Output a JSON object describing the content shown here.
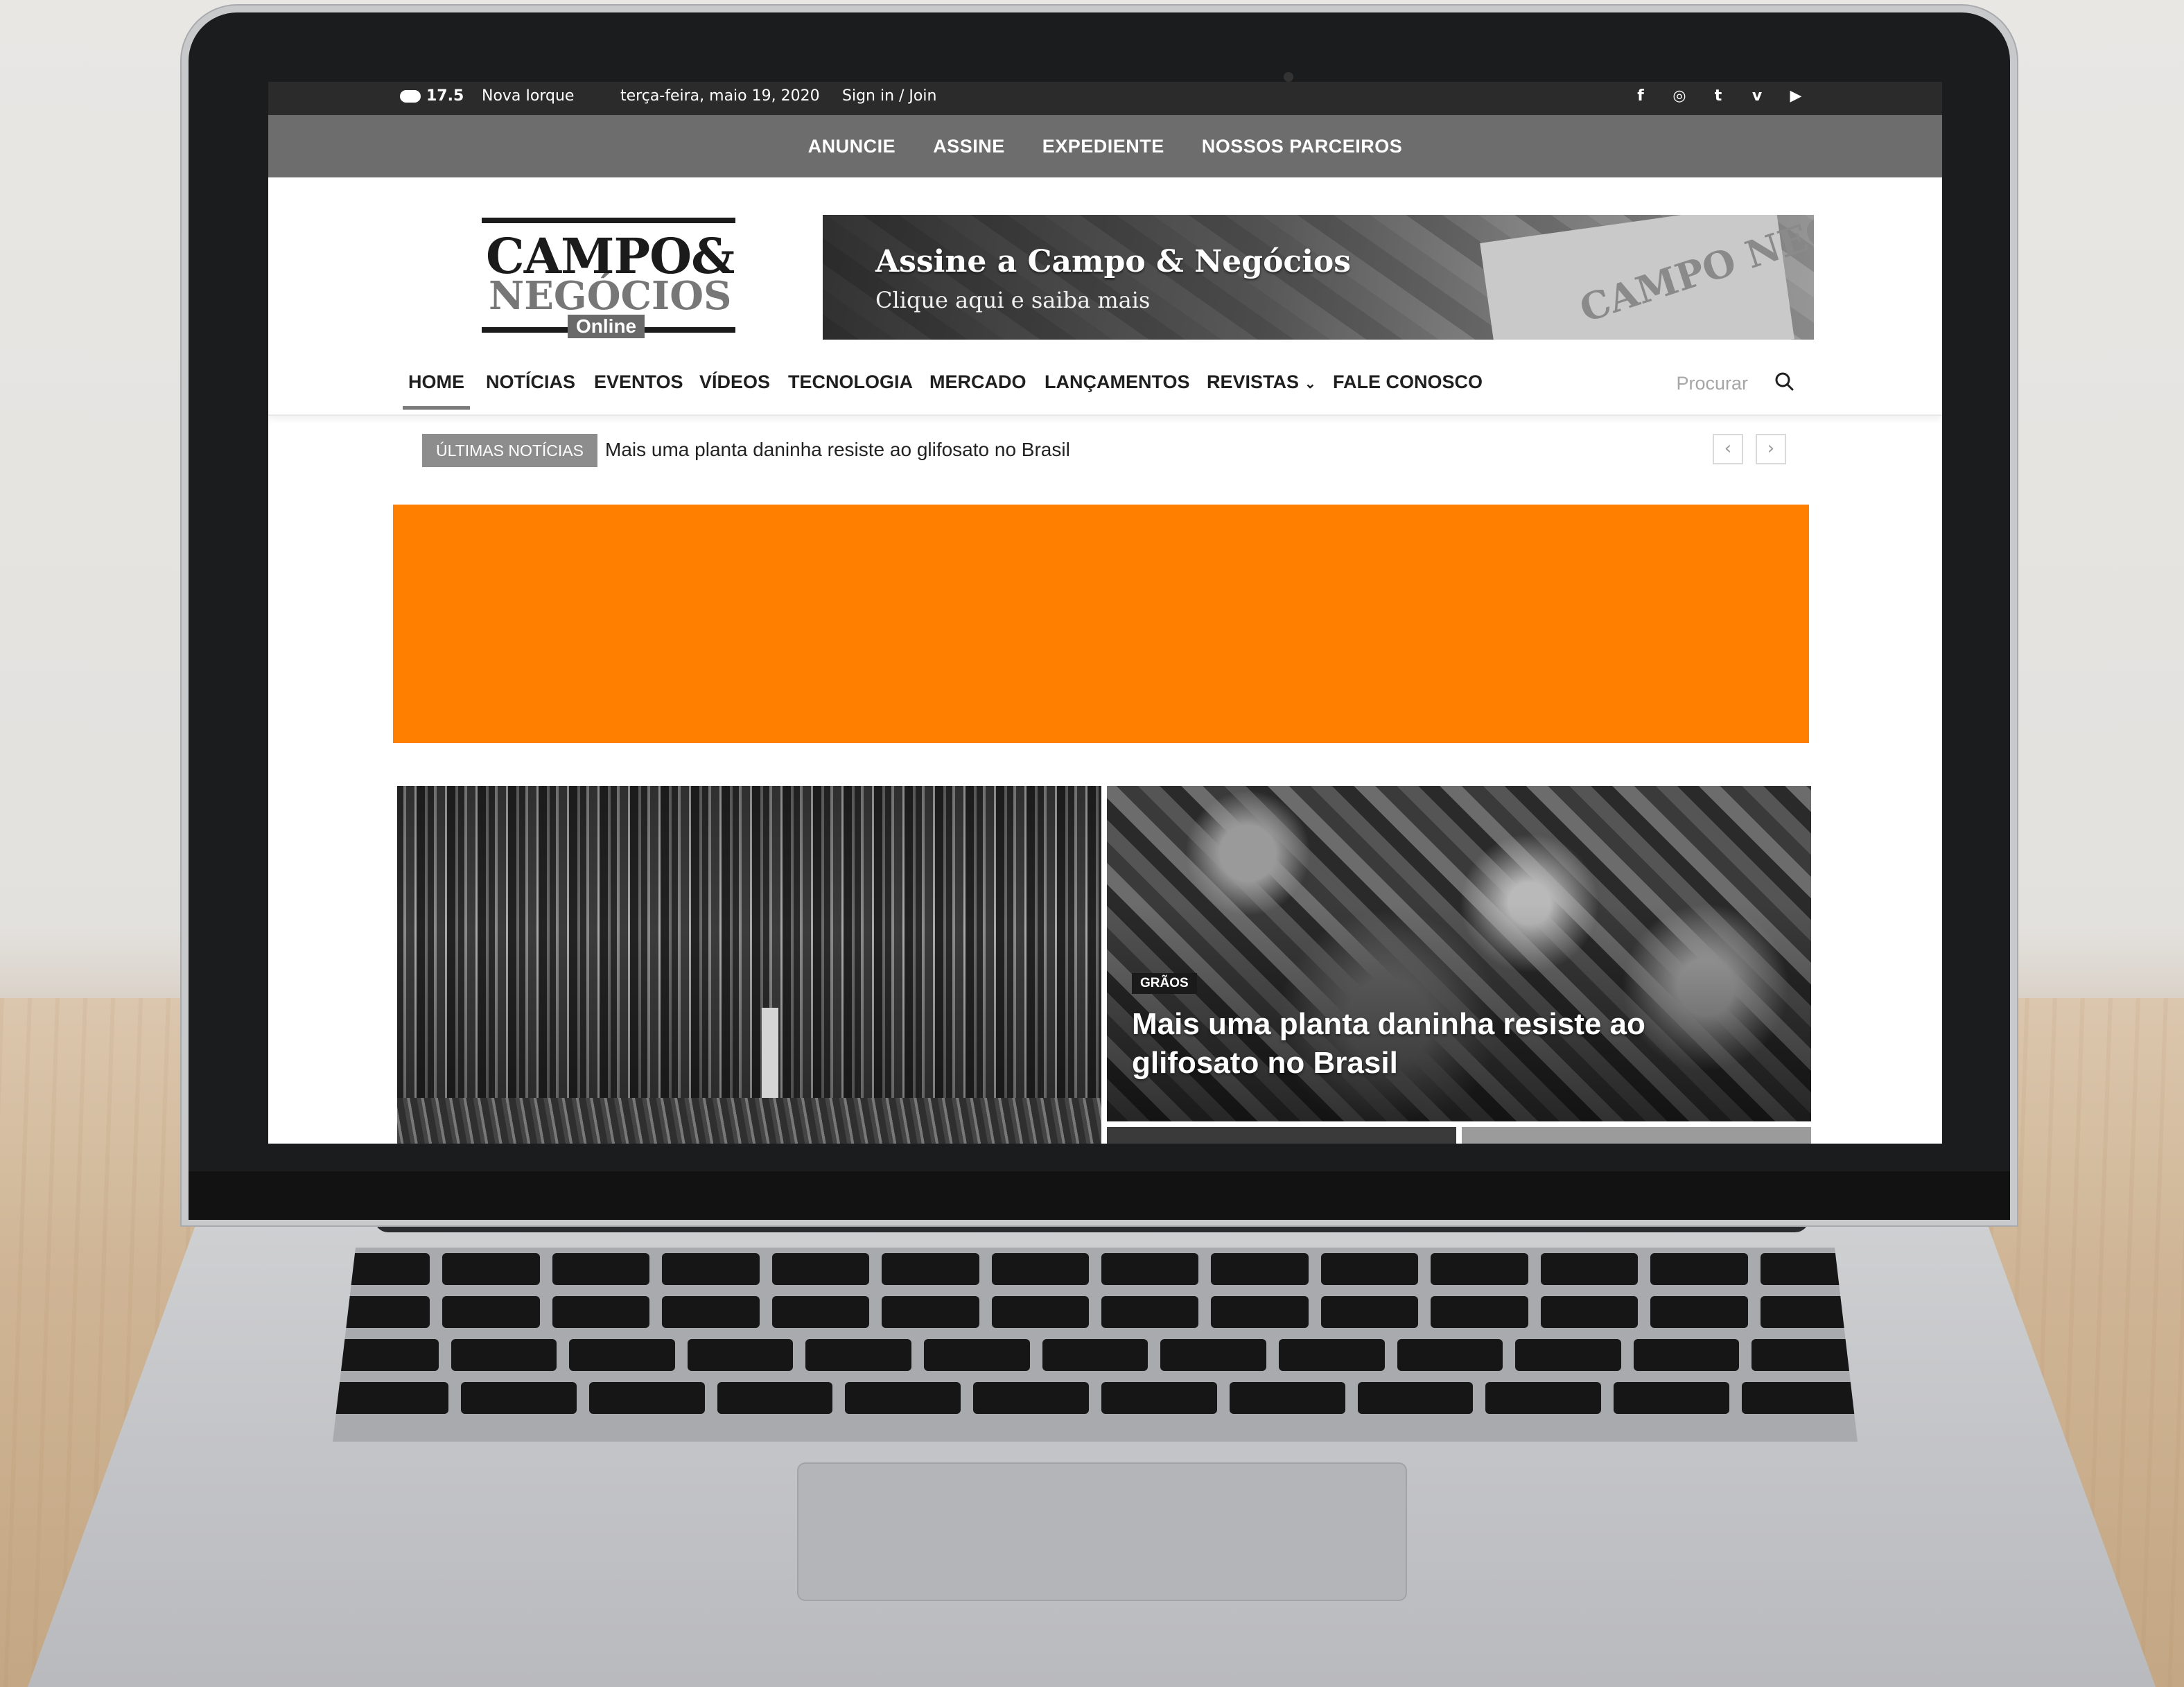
{
  "topbar": {
    "temperature": "17.5",
    "city": "Nova Iorque",
    "date": "terça-feira, maio 19, 2020",
    "signin": "Sign in / Join",
    "socials": [
      {
        "icon": "facebook-icon",
        "glyph": "f"
      },
      {
        "icon": "instagram-icon",
        "glyph": "◎"
      },
      {
        "icon": "twitter-icon",
        "glyph": "t"
      },
      {
        "icon": "vimeo-icon",
        "glyph": "v"
      },
      {
        "icon": "youtube-icon",
        "glyph": "▶"
      }
    ]
  },
  "subnav": {
    "items": [
      "ANUNCIE",
      "ASSINE",
      "EXPEDIENTE",
      "NOSSOS PARCEIROS"
    ]
  },
  "logo": {
    "line1": "CAMPO&",
    "line2": "NEGÓCIOS",
    "tag": "Online"
  },
  "banner": {
    "title": "Assine a Campo & Negócios",
    "subtitle": "Clique aqui e saiba mais",
    "magazine_title": "CAMPO NEGÓCIOS"
  },
  "mainnav": {
    "items": [
      {
        "label": "HOME"
      },
      {
        "label": "NOTÍCIAS"
      },
      {
        "label": "EVENTOS"
      },
      {
        "label": "VÍDEOS"
      },
      {
        "label": "TECNOLOGIA"
      },
      {
        "label": "MERCADO"
      },
      {
        "label": "LANÇAMENTOS"
      },
      {
        "label": "REVISTAS"
      },
      {
        "label": "FALE CONOSCO"
      }
    ],
    "active": "HOME",
    "search_label": "Procurar"
  },
  "ticker": {
    "badge": "ÚLTIMAS NOTÍCIAS",
    "headline": "Mais uma planta daninha resiste ao glifosato no Brasil",
    "prev": "‹",
    "next": "›"
  },
  "ad": {
    "color": "#ff7f00"
  },
  "featured": {
    "right_category": "GRÃOS",
    "right_title": "Mais uma planta daninha resiste ao glifosato no Brasil"
  }
}
